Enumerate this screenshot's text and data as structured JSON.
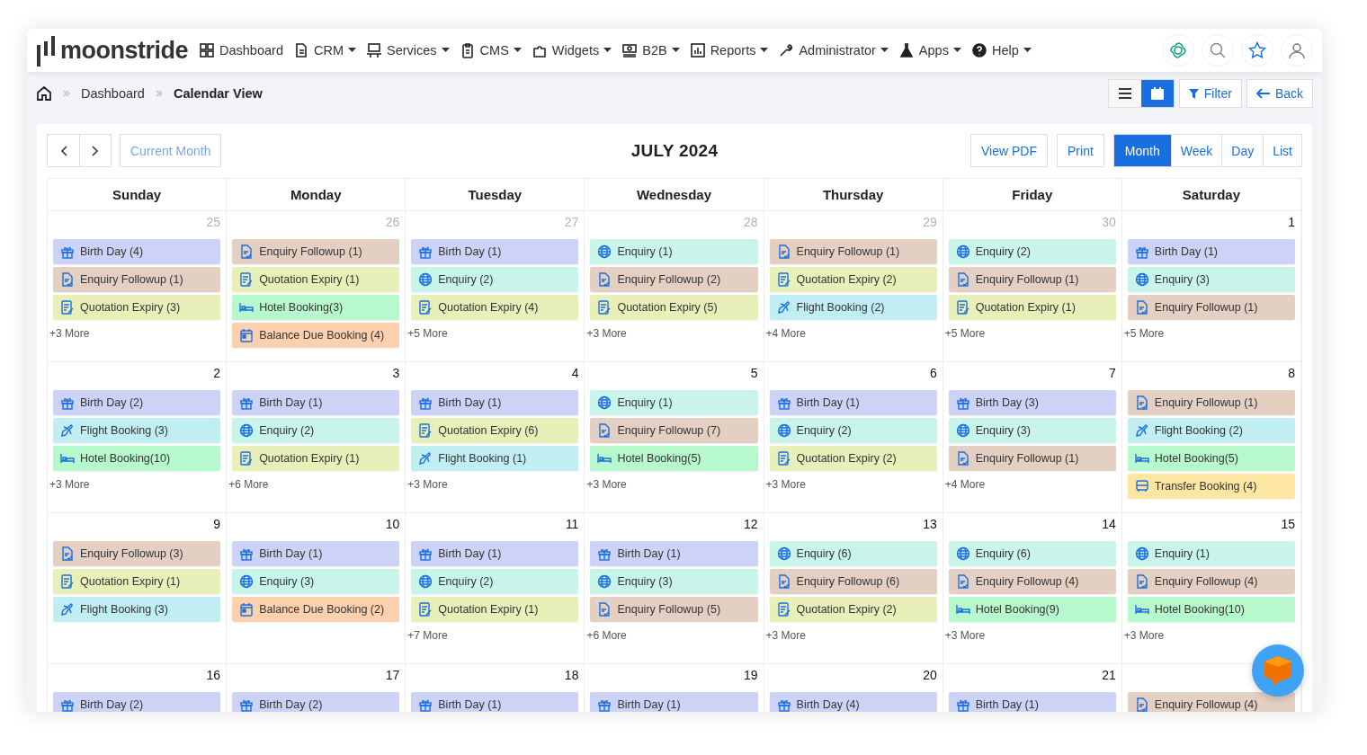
{
  "brand": "moonstride",
  "nav": [
    {
      "label": "Dashboard",
      "caret": false
    },
    {
      "label": "CRM",
      "caret": true
    },
    {
      "label": "Services",
      "caret": true
    },
    {
      "label": "CMS",
      "caret": true
    },
    {
      "label": "Widgets",
      "caret": true
    },
    {
      "label": "B2B",
      "caret": true
    },
    {
      "label": "Reports",
      "caret": true
    },
    {
      "label": "Administrator",
      "caret": true
    },
    {
      "label": "Apps",
      "caret": true
    },
    {
      "label": "Help",
      "caret": true
    }
  ],
  "breadcrumb": [
    "Dashboard",
    "Calendar View"
  ],
  "view_toggle": [
    {
      "selected": false
    },
    {
      "selected": true
    }
  ],
  "actions": [
    "Filter",
    "Back"
  ],
  "calendar": {
    "current_button": "Current Month",
    "title": "JULY 2024",
    "pdf": "View PDF",
    "print": "Print",
    "views": [
      {
        "label": "Month",
        "selected": true
      },
      {
        "label": "Week",
        "selected": false
      },
      {
        "label": "Day",
        "selected": false
      },
      {
        "label": "List",
        "selected": false
      }
    ],
    "weekdays": [
      "Sunday",
      "Monday",
      "Tuesday",
      "Wednesday",
      "Thursday",
      "Friday",
      "Saturday"
    ],
    "weeks": [
      [
        {
          "day": "25",
          "other_month": true,
          "more": "+3 More",
          "events": [
            {
              "kind": "birthday",
              "label": "Birth Day (4)"
            },
            {
              "kind": "followup",
              "label": "Enquiry Followup (1)"
            },
            {
              "kind": "quotation",
              "label": "Quotation Expiry (3)"
            }
          ]
        },
        {
          "day": "26",
          "other_month": true,
          "events": [
            {
              "kind": "followup",
              "label": "Enquiry Followup (1)"
            },
            {
              "kind": "quotation",
              "label": "Quotation Expiry (1)"
            },
            {
              "kind": "hotel",
              "label": "Hotel Booking(3)"
            },
            {
              "kind": "balance",
              "label": "Balance Due Booking (4)"
            }
          ]
        },
        {
          "day": "27",
          "other_month": true,
          "more": "+5 More",
          "events": [
            {
              "kind": "birthday",
              "label": "Birth Day (1)"
            },
            {
              "kind": "enquiry",
              "label": "Enquiry (2)"
            },
            {
              "kind": "quotation",
              "label": "Quotation Expiry (4)"
            }
          ]
        },
        {
          "day": "28",
          "other_month": true,
          "more": "+3 More",
          "events": [
            {
              "kind": "enquiry",
              "label": "Enquiry (1)"
            },
            {
              "kind": "followup",
              "label": "Enquiry Followup (2)"
            },
            {
              "kind": "quotation",
              "label": "Quotation Expiry (5)"
            }
          ]
        },
        {
          "day": "29",
          "other_month": true,
          "more": "+4 More",
          "events": [
            {
              "kind": "followup",
              "label": "Enquiry Followup (1)"
            },
            {
              "kind": "quotation",
              "label": "Quotation Expiry (2)"
            },
            {
              "kind": "flight",
              "label": "Flight Booking (2)"
            }
          ]
        },
        {
          "day": "30",
          "other_month": true,
          "more": "+5 More",
          "events": [
            {
              "kind": "enquiry",
              "label": "Enquiry (2)"
            },
            {
              "kind": "followup",
              "label": "Enquiry Followup (1)"
            },
            {
              "kind": "quotation",
              "label": "Quotation Expiry (1)"
            }
          ]
        },
        {
          "day": "1",
          "other_month": false,
          "more": "+5 More",
          "events": [
            {
              "kind": "birthday",
              "label": "Birth Day (1)"
            },
            {
              "kind": "enquiry",
              "label": "Enquiry (3)"
            },
            {
              "kind": "followup",
              "label": "Enquiry Followup (1)"
            }
          ]
        }
      ],
      [
        {
          "day": "2",
          "other_month": false,
          "more": "+3 More",
          "events": [
            {
              "kind": "birthday",
              "label": "Birth Day (2)"
            },
            {
              "kind": "flight",
              "label": "Flight Booking (3)"
            },
            {
              "kind": "hotel",
              "label": "Hotel Booking(10)"
            }
          ]
        },
        {
          "day": "3",
          "other_month": false,
          "more": "+6 More",
          "events": [
            {
              "kind": "birthday",
              "label": "Birth Day (1)"
            },
            {
              "kind": "enquiry",
              "label": "Enquiry (2)"
            },
            {
              "kind": "quotation",
              "label": "Quotation Expiry (1)"
            }
          ]
        },
        {
          "day": "4",
          "other_month": false,
          "more": "+3 More",
          "events": [
            {
              "kind": "birthday",
              "label": "Birth Day (1)"
            },
            {
              "kind": "quotation",
              "label": "Quotation Expiry (6)"
            },
            {
              "kind": "flight",
              "label": "Flight Booking (1)"
            }
          ]
        },
        {
          "day": "5",
          "other_month": false,
          "more": "+3 More",
          "events": [
            {
              "kind": "enquiry",
              "label": "Enquiry (1)"
            },
            {
              "kind": "followup",
              "label": "Enquiry Followup (7)"
            },
            {
              "kind": "hotel",
              "label": "Hotel Booking(5)"
            }
          ]
        },
        {
          "day": "6",
          "other_month": false,
          "more": "+3 More",
          "events": [
            {
              "kind": "birthday",
              "label": "Birth Day (1)"
            },
            {
              "kind": "enquiry",
              "label": "Enquiry (2)"
            },
            {
              "kind": "quotation",
              "label": "Quotation Expiry (2)"
            }
          ]
        },
        {
          "day": "7",
          "other_month": false,
          "more": "+4 More",
          "events": [
            {
              "kind": "birthday",
              "label": "Birth Day (3)"
            },
            {
              "kind": "enquiry",
              "label": "Enquiry (3)"
            },
            {
              "kind": "followup",
              "label": "Enquiry Followup (1)"
            }
          ]
        },
        {
          "day": "8",
          "other_month": false,
          "events": [
            {
              "kind": "followup",
              "label": "Enquiry Followup (1)"
            },
            {
              "kind": "flight",
              "label": "Flight Booking (2)"
            },
            {
              "kind": "hotel",
              "label": "Hotel Booking(5)"
            },
            {
              "kind": "transfer",
              "label": "Transfer Booking (4)"
            }
          ]
        }
      ],
      [
        {
          "day": "9",
          "other_month": false,
          "events": [
            {
              "kind": "followup",
              "label": "Enquiry Followup (3)"
            },
            {
              "kind": "quotation",
              "label": "Quotation Expiry (1)"
            },
            {
              "kind": "flight",
              "label": "Flight Booking (3)"
            }
          ]
        },
        {
          "day": "10",
          "other_month": false,
          "events": [
            {
              "kind": "birthday",
              "label": "Birth Day (1)"
            },
            {
              "kind": "enquiry",
              "label": "Enquiry (3)"
            },
            {
              "kind": "balance",
              "label": "Balance Due Booking (2)"
            }
          ]
        },
        {
          "day": "11",
          "other_month": false,
          "more": "+7 More",
          "events": [
            {
              "kind": "birthday",
              "label": "Birth Day (1)"
            },
            {
              "kind": "enquiry",
              "label": "Enquiry (2)"
            },
            {
              "kind": "quotation",
              "label": "Quotation Expiry (1)"
            }
          ]
        },
        {
          "day": "12",
          "other_month": false,
          "more": "+6 More",
          "events": [
            {
              "kind": "birthday",
              "label": "Birth Day (1)"
            },
            {
              "kind": "enquiry",
              "label": "Enquiry (3)"
            },
            {
              "kind": "followup",
              "label": "Enquiry Followup (5)"
            }
          ]
        },
        {
          "day": "13",
          "other_month": false,
          "more": "+3 More",
          "events": [
            {
              "kind": "enquiry",
              "label": "Enquiry (6)"
            },
            {
              "kind": "followup",
              "label": "Enquiry Followup (6)"
            },
            {
              "kind": "quotation",
              "label": "Quotation Expiry (2)"
            }
          ]
        },
        {
          "day": "14",
          "other_month": false,
          "more": "+3 More",
          "events": [
            {
              "kind": "enquiry",
              "label": "Enquiry (6)"
            },
            {
              "kind": "followup",
              "label": "Enquiry Followup (4)"
            },
            {
              "kind": "hotel",
              "label": "Hotel Booking(9)"
            }
          ]
        },
        {
          "day": "15",
          "other_month": false,
          "more": "+3 More",
          "events": [
            {
              "kind": "enquiry",
              "label": "Enquiry (1)"
            },
            {
              "kind": "followup",
              "label": "Enquiry Followup (4)"
            },
            {
              "kind": "hotel",
              "label": "Hotel Booking(10)"
            }
          ]
        }
      ],
      [
        {
          "day": "16",
          "other_month": false,
          "events": [
            {
              "kind": "birthday",
              "label": "Birth Day (2)"
            }
          ]
        },
        {
          "day": "17",
          "other_month": false,
          "events": [
            {
              "kind": "birthday",
              "label": "Birth Day (2)"
            }
          ]
        },
        {
          "day": "18",
          "other_month": false,
          "events": [
            {
              "kind": "birthday",
              "label": "Birth Day (1)"
            }
          ]
        },
        {
          "day": "19",
          "other_month": false,
          "events": [
            {
              "kind": "birthday",
              "label": "Birth Day (1)"
            }
          ]
        },
        {
          "day": "20",
          "other_month": false,
          "events": [
            {
              "kind": "birthday",
              "label": "Birth Day (4)"
            }
          ]
        },
        {
          "day": "21",
          "other_month": false,
          "events": [
            {
              "kind": "birthday",
              "label": "Birth Day (1)"
            }
          ]
        },
        {
          "events": [
            {
              "kind": "followup",
              "label": "Enquiry Followup (4)"
            }
          ]
        }
      ]
    ]
  }
}
